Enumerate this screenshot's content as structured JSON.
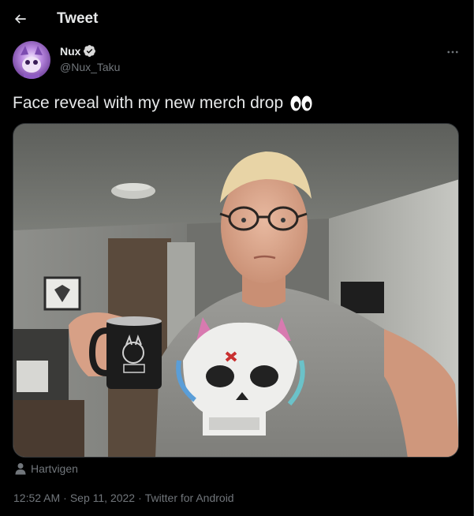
{
  "header": {
    "title": "Tweet",
    "back_icon": "arrow-left-icon"
  },
  "author": {
    "name": "Nux",
    "handle": "@Nux_Taku",
    "verified": true,
    "verified_color": "#d9d9d9"
  },
  "more_icon": "more-horizontal-icon",
  "tweet": {
    "text": "Face reveal with my new merch drop",
    "emoji": "eyes-emoji",
    "media_alt": "photo of man in glasses holding mug"
  },
  "tag": {
    "icon": "person-icon",
    "name": "Hartvigen"
  },
  "meta": {
    "time": "12:52 AM",
    "sep1": "·",
    "date": "Sep 11, 2022",
    "sep2": "·",
    "source": "Twitter for Android"
  },
  "colors": {
    "background": "#000000",
    "text_primary": "#e7e9ea",
    "text_secondary": "#71767b",
    "border": "#2f3336"
  }
}
